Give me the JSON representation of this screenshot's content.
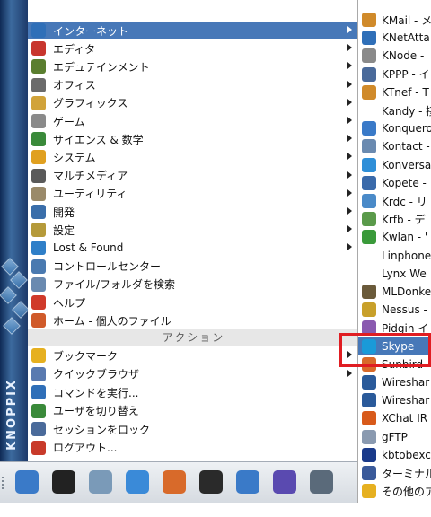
{
  "brand": "KNOPPIX",
  "main_menu": {
    "items": [
      {
        "label": "インターネット",
        "icon": "globe-icon",
        "color": "#2f6fb8",
        "has_sub": true,
        "active": true
      },
      {
        "label": "エディタ",
        "icon": "pen-icon",
        "color": "#c8362e",
        "has_sub": true
      },
      {
        "label": "エデュテインメント",
        "icon": "board-icon",
        "color": "#5a7e2f",
        "has_sub": true
      },
      {
        "label": "オフィス",
        "icon": "office-icon",
        "color": "#6b6b6b",
        "has_sub": true
      },
      {
        "label": "グラフィックス",
        "icon": "brush-icon",
        "color": "#d1a33a",
        "has_sub": true
      },
      {
        "label": "ゲーム",
        "icon": "game-icon",
        "color": "#8a8a8a",
        "has_sub": true
      },
      {
        "label": "サイエンス & 数学",
        "icon": "science-icon",
        "color": "#3a8a3a",
        "has_sub": true
      },
      {
        "label": "システム",
        "icon": "system-icon",
        "color": "#e0a020",
        "has_sub": true
      },
      {
        "label": "マルチメディア",
        "icon": "multimedia-icon",
        "color": "#5a5a5a",
        "has_sub": true
      },
      {
        "label": "ユーティリティ",
        "icon": "utility-icon",
        "color": "#9a8a6a",
        "has_sub": true
      },
      {
        "label": "開発",
        "icon": "develop-icon",
        "color": "#3a6eaa",
        "has_sub": true
      },
      {
        "label": "設定",
        "icon": "settings-icon",
        "color": "#b59a3a",
        "has_sub": true
      },
      {
        "label": "Lost & Found",
        "icon": "lostfound-icon",
        "color": "#2f7fc8",
        "has_sub": true
      },
      {
        "label": "コントロールセンター",
        "icon": "control-center-icon",
        "color": "#4a7ab0",
        "has_sub": false
      },
      {
        "label": "ファイル/フォルダを検索",
        "icon": "search-icon",
        "color": "#6a8ab0",
        "has_sub": false
      },
      {
        "label": "ヘルプ",
        "icon": "help-icon",
        "color": "#d03a2a",
        "has_sub": false
      },
      {
        "label": "ホーム - 個人のファイル",
        "icon": "home-icon",
        "color": "#d05a2a",
        "has_sub": false
      }
    ],
    "section_header": "アクション",
    "actions": [
      {
        "label": "ブックマーク",
        "icon": "bookmark-icon",
        "color": "#e6b020",
        "has_sub": true
      },
      {
        "label": "クイックブラウザ",
        "icon": "quick-browser-icon",
        "color": "#5a7ab0",
        "has_sub": true
      },
      {
        "label": "コマンドを実行...",
        "icon": "run-command-icon",
        "color": "#2f6fb8",
        "has_sub": false
      },
      {
        "label": "ユーザを切り替え",
        "icon": "switch-user-icon",
        "color": "#3a8a3a",
        "has_sub": false
      },
      {
        "label": "セッションをロック",
        "icon": "lock-icon",
        "color": "#4a6a9a",
        "has_sub": false
      },
      {
        "label": "ログアウト...",
        "icon": "logout-icon",
        "color": "#c83a2a",
        "has_sub": false
      }
    ]
  },
  "sub_menu": {
    "items": [
      {
        "label": "KMail - メ",
        "icon": "kmail-icon",
        "color": "#d08a2a"
      },
      {
        "label": "KNetAtta",
        "icon": "knetattach-icon",
        "color": "#2f6fb8"
      },
      {
        "label": "KNode -",
        "icon": "knode-icon",
        "color": "#8a8a8a"
      },
      {
        "label": "KPPP - イ",
        "icon": "kppp-icon",
        "color": "#4a6a9a"
      },
      {
        "label": "KTnef - T",
        "icon": "ktnef-icon",
        "color": "#d08a2a"
      },
      {
        "label": "Kandy - 接",
        "icon": "",
        "color": ""
      },
      {
        "label": "Konquero",
        "icon": "konqueror-icon",
        "color": "#3a7ac8"
      },
      {
        "label": "Kontact -",
        "icon": "kontact-icon",
        "color": "#6a8ab0"
      },
      {
        "label": "Konversa",
        "icon": "konversation-icon",
        "color": "#2f8fd8"
      },
      {
        "label": "Kopete -",
        "icon": "kopete-icon",
        "color": "#3a6aaa"
      },
      {
        "label": "Krdc - リ",
        "icon": "krdc-icon",
        "color": "#4a8ac8"
      },
      {
        "label": "Krfb - デ",
        "icon": "krfb-icon",
        "color": "#5a9a4a"
      },
      {
        "label": "Kwlan - '",
        "icon": "kwlan-icon",
        "color": "#3a9a3a"
      },
      {
        "label": "Linphone",
        "icon": "",
        "color": ""
      },
      {
        "label": "Lynx We",
        "icon": "",
        "color": ""
      },
      {
        "label": "MLDonke",
        "icon": "mldonkey-icon",
        "color": "#6a5a3a"
      },
      {
        "label": "Nessus -",
        "icon": "nessus-icon",
        "color": "#c8a02a"
      },
      {
        "label": "Pidgin イ",
        "icon": "pidgin-icon",
        "color": "#8a5ab0"
      },
      {
        "label": "Skype",
        "icon": "skype-icon",
        "color": "#1a9ad8",
        "active": true
      },
      {
        "label": "Sunbird",
        "icon": "sunbird-icon",
        "color": "#d86a2a"
      },
      {
        "label": "Wireshar",
        "icon": "wireshark-icon",
        "color": "#2a5a9a"
      },
      {
        "label": "Wireshar",
        "icon": "wireshark-icon",
        "color": "#2a5a9a"
      },
      {
        "label": "XChat IR",
        "icon": "xchat-icon",
        "color": "#d85a1a"
      },
      {
        "label": "gFTP",
        "icon": "gftp-icon",
        "color": "#8a9ab0"
      },
      {
        "label": "kbtobexc",
        "icon": "bluetooth-icon",
        "color": "#1a3a8a"
      },
      {
        "label": "ターミナル",
        "icon": "terminal-icon",
        "color": "#3a5a9a"
      },
      {
        "label": "その他のア",
        "icon": "more-apps-icon",
        "color": "#e6b020"
      }
    ]
  },
  "taskbar": {
    "buttons": [
      {
        "name": "kmenu-button",
        "icon": "kde-icon",
        "color": "#3a7ac8"
      },
      {
        "name": "tux-button",
        "icon": "tux-icon",
        "color": "#222222"
      },
      {
        "name": "kdesktop-button",
        "icon": "desktop-icon",
        "color": "#7a9ab8"
      },
      {
        "name": "brush-button",
        "icon": "paint-icon",
        "color": "#3a8ad8"
      },
      {
        "name": "home-button",
        "icon": "home-icon",
        "color": "#d86a2a"
      },
      {
        "name": "terminal-button",
        "icon": "terminal-icon",
        "color": "#2a2a2a"
      },
      {
        "name": "konqueror-button",
        "icon": "konqueror-icon",
        "color": "#3a7ac8"
      },
      {
        "name": "browser-button",
        "icon": "globe-icon",
        "color": "#5a4ab0"
      },
      {
        "name": "editor-button",
        "icon": "editor-icon",
        "color": "#5a6a7a"
      }
    ]
  }
}
